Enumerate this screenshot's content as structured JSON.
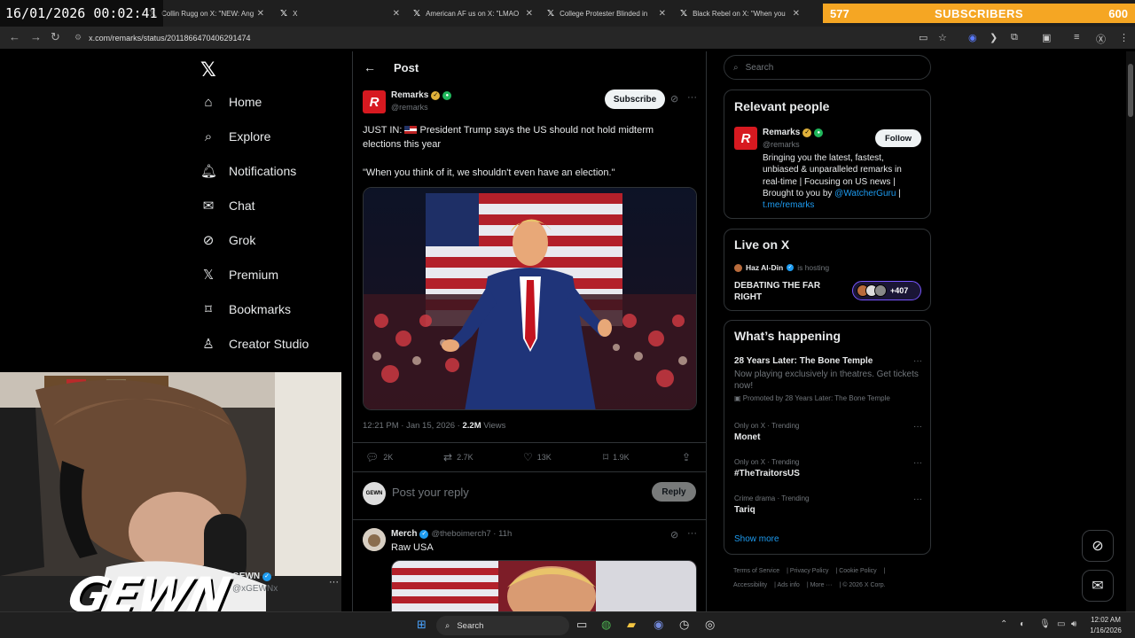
{
  "overlay": {
    "datetime": "16/01/2026 00:02:41",
    "subs_current": "577",
    "subs_label": "SUBSCRIBERS",
    "subs_goal": "600"
  },
  "browser": {
    "tabs": [
      {
        "title": "Collin Rugg on X: \"NEW: Ang"
      },
      {
        "title": "X"
      },
      {
        "title": "American AF us on X: \"LMAO"
      },
      {
        "title": "College Protester Blinded in"
      },
      {
        "title": "Black Rebel on X: \"When you"
      }
    ],
    "url": "x.com/remarks/status/2011866470406291474"
  },
  "sidebar": {
    "items": [
      {
        "label": "Home",
        "icon": "home-icon"
      },
      {
        "label": "Explore",
        "icon": "search-icon"
      },
      {
        "label": "Notifications",
        "icon": "bell-icon"
      },
      {
        "label": "Chat",
        "icon": "mail-icon"
      },
      {
        "label": "Grok",
        "icon": "grok-icon"
      },
      {
        "label": "Premium",
        "icon": "x-logo-icon"
      },
      {
        "label": "Bookmarks",
        "icon": "bookmark-icon"
      },
      {
        "label": "Creator Studio",
        "icon": "creator-icon"
      }
    ]
  },
  "post": {
    "header": "Post",
    "author_name": "Remarks",
    "author_handle": "@remarks",
    "avatar_letter": "R",
    "subscribe_label": "Subscribe",
    "text_line1": "JUST IN:",
    "text_line1b": "President Trump says the US should not hold midterm elections this year",
    "text_quote": "\"When you think of it, we shouldn't even have an election.\"",
    "time": "12:21 PM · Jan 15, 2026 ·",
    "views": "2.2M",
    "views_label": "Views",
    "replies": "2K",
    "reposts": "2.7K",
    "likes": "13K",
    "bookmarks": "1.9K",
    "reply_placeholder": "Post your reply",
    "reply_label": "Reply",
    "reply_avatar_text": "GEWN"
  },
  "reply": {
    "name": "Merch",
    "handle": "@theboimerch7 · 11h",
    "text": "Raw USA"
  },
  "right": {
    "search_placeholder": "Search",
    "relevant_title": "Relevant people",
    "person_name": "Remarks",
    "person_handle": "@remarks",
    "follow_label": "Follow",
    "bio_text": "Bringing you the latest, fastest, unbiased & unparalleled remarks in real-time | Focusing on US news | Brought to you by",
    "bio_link1": "@WatcherGuru",
    "bio_sep": " |",
    "bio_link2": "t.me/remarks",
    "live_title": "Live on X",
    "host_name": "Haz Al-Din",
    "host_status": "is hosting",
    "space_title": "DEBATING THE FAR RIGHT",
    "space_count": "+407",
    "happening_title": "What’s happening",
    "trends": [
      {
        "ctx": "",
        "name": "28 Years Later: The Bone Temple",
        "desc": "Now playing exclusively in theatres. Get tickets now!",
        "promo": "Promoted by 28 Years Later: The Bone Temple"
      },
      {
        "ctx": "Only on X · Trending",
        "name": "Monet"
      },
      {
        "ctx": "Only on X · Trending",
        "name": "#TheTraitorsUS"
      },
      {
        "ctx": "Crime drama · Trending",
        "name": "Tariq"
      }
    ],
    "show_more": "Show more",
    "footer": [
      "Terms of Service",
      "Privacy Policy",
      "Cookie Policy",
      "Accessibility",
      "Ads info",
      "More ···",
      "© 2026 X Corp."
    ]
  },
  "stream": {
    "logo_text": "GEWN",
    "account_name": "GEWN",
    "account_handle": "@xGEWNx"
  },
  "taskbar": {
    "search_label": "Search",
    "time": "12:02 AM",
    "date": "1/16/2026"
  },
  "colors": {
    "accent": "#1d9bf0",
    "brand_red": "#d71920",
    "subs_bar": "#f5a623"
  }
}
